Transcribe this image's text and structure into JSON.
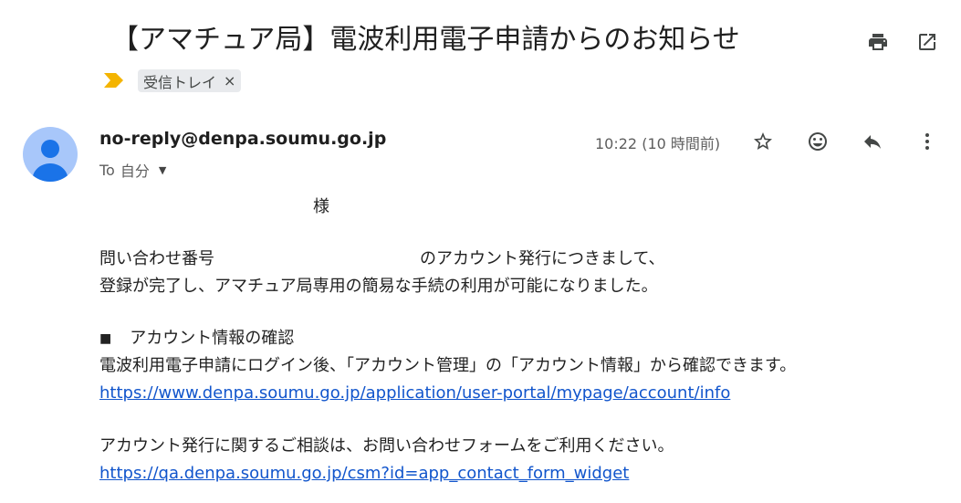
{
  "email": {
    "subject": "【アマチュア局】電波利用電子申請からのお知らせ",
    "label": "受信トレイ",
    "label_close": "×",
    "sender": "no-reply@denpa.soumu.go.jp",
    "to_prefix": "To",
    "to_name": "自分",
    "timestamp": "10:22 (10 時間前)",
    "body": {
      "salutation": "様",
      "line1_start": "問い合わせ番号",
      "line1_end": "のアカウント発行につきまして、",
      "line2": "登録が完了し、アマチュア局専用の簡易な手続の利用が可能になりました。",
      "bullet": "■",
      "heading": "アカウント情報の確認",
      "line4": "電波利用電子申請にログイン後、「アカウント管理」の「アカウント情報」から確認できます。",
      "link1": "https://www.denpa.soumu.go.jp/application/user-portal/mypage/account/info",
      "line5": "アカウント発行に関するご相談は、お問い合わせフォームをご利用ください。",
      "link2": "https://qa.denpa.soumu.go.jp/csm?id=app_contact_form_widget"
    }
  },
  "icons": {
    "print": "print-icon",
    "popout": "open-in-new-window-icon",
    "importance": "importance-marker-icon",
    "avatar": "default-avatar-icon",
    "star": "star-icon",
    "emoji": "emoji-reaction-icon",
    "reply": "reply-icon",
    "more": "more-vert-icon",
    "caret": "chevron-down-icon"
  },
  "colors": {
    "link": "#1155cc",
    "importance": "#f4b400",
    "avatar_bg": "#a8c7fa",
    "avatar_fg": "#1a73e8",
    "chip_bg": "#e8eaed"
  }
}
